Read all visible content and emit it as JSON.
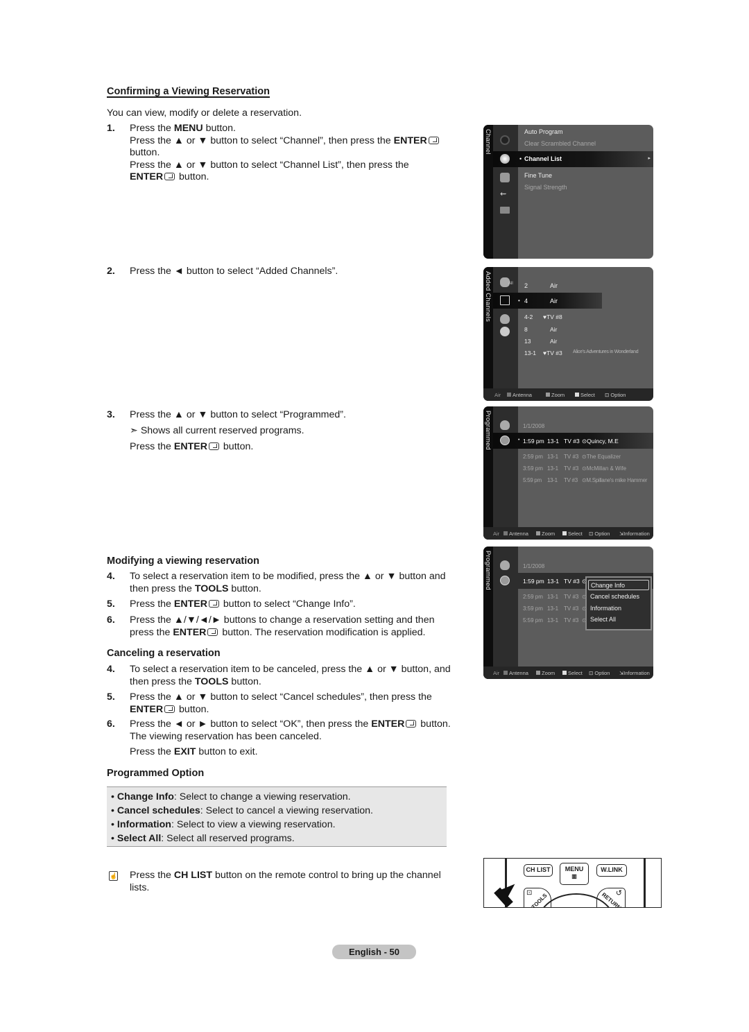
{
  "doc": {
    "section_title": "Confirming a Viewing Reservation",
    "intro": "You can view, modify or delete a reservation.",
    "steps_confirm": [
      {
        "num": "1.",
        "lines": [
          {
            "pre": "Press the ",
            "bold": "MENU",
            "post": " button."
          },
          {
            "pre": "Press the ▲ or ▼ button to select “Channel”, then press the ",
            "bold": "ENTER",
            "post": ""
          },
          {
            "pre": "button.",
            "bold": "",
            "post": ""
          },
          {
            "pre": "Press the ▲ or ▼ button to select “Channel List”, then press the",
            "bold": "",
            "post": ""
          },
          {
            "pre": "",
            "bold": "ENTER",
            "post": " button."
          }
        ]
      },
      {
        "num": "2.",
        "lines": [
          {
            "pre": "Press the ◄ button to select “Added Channels”.",
            "bold": "",
            "post": ""
          }
        ]
      },
      {
        "num": "3.",
        "lines": [
          {
            "pre": "Press the ▲ or ▼ button to select “Programmed”.",
            "bold": "",
            "post": ""
          },
          {
            "pre": "➣  Shows all current reserved programs.",
            "bold": "",
            "post": ""
          },
          {
            "pre": "Press the ",
            "bold": "ENTER",
            "post": " button."
          }
        ]
      }
    ],
    "modify_title": "Modifying a viewing reservation",
    "steps_modify": [
      {
        "num": "4.",
        "l1": "To select a reservation item to be modified, press the ▲ or ▼ button and",
        "l2_pre": "then press the ",
        "l2_bold": "TOOLS",
        "l2_post": " button."
      },
      {
        "num": "5.",
        "l1_pre": "Press the ",
        "l1_bold": "ENTER",
        "l1_post": " button to select “Change Info”."
      },
      {
        "num": "6.",
        "l1": "Press the ▲/▼/◄/► buttons to change a reservation setting and then",
        "l2_pre": "press the ",
        "l2_bold": "ENTER",
        "l2_post": " button. The reservation modification is applied."
      }
    ],
    "cancel_title": "Canceling a reservation",
    "steps_cancel": [
      {
        "num": "4.",
        "l1": "To select a reservation item to be canceled, press the ▲ or ▼ button, and",
        "l2_pre": "then press the ",
        "l2_bold": "TOOLS",
        "l2_post": " button."
      },
      {
        "num": "5.",
        "l1": "Press the ▲ or ▼ button to select “Cancel schedules”, then press the",
        "l2_bold": "ENTER",
        "l2_post": " button."
      },
      {
        "num": "6.",
        "l1_pre": "Press the ◄ or ► button to select “OK”, then press the ",
        "l1_bold": "ENTER",
        "l1_post": " button.",
        "l2": "The viewing reservation has been canceled.",
        "l3_pre": "Press the ",
        "l3_bold": "EXIT",
        "l3_post": " button to exit."
      }
    ],
    "options_title": "Programmed Option",
    "options": [
      {
        "name": "Change Info",
        "desc": ": Select to change a viewing reservation."
      },
      {
        "name": "Cancel schedules",
        "desc": ": Select to cancel a viewing reservation."
      },
      {
        "name": "Information",
        "desc": ": Select to view a viewing reservation."
      },
      {
        "name": "Select All",
        "desc": ": Select all reserved programs."
      }
    ],
    "note": {
      "pre": "Press the ",
      "bold": "CH LIST",
      "post": " button on the remote control to bring up the channel",
      "l2": "lists."
    },
    "page_label": "English - 50"
  },
  "osd_channel": {
    "tab": "Channel",
    "items": [
      "Auto Program",
      "Clear Scrambled Channel",
      "Channel List",
      "Fine Tune",
      "Signal Strength"
    ],
    "selected": "Channel List"
  },
  "osd_added": {
    "tab": "Added Channels",
    "all_label": "All",
    "rows": [
      {
        "ch": "2",
        "name": "Air",
        "prog": ""
      },
      {
        "ch": "4",
        "name": "Air",
        "prog": ""
      },
      {
        "ch": "4-2",
        "name": "♥TV #8",
        "prog": ""
      },
      {
        "ch": "8",
        "name": "Air",
        "prog": ""
      },
      {
        "ch": "13",
        "name": "Air",
        "prog": ""
      },
      {
        "ch": "13-1",
        "name": "♥TV #3",
        "prog": "Alice's Adventures in Wonderland"
      }
    ],
    "footer": {
      "source": "Air",
      "a": "Antenna",
      "b": "Zoom",
      "c": "Select",
      "d": "Option"
    }
  },
  "osd_programmed": {
    "tab": "Programmed",
    "date": "1/1/2008",
    "rows": [
      {
        "time": "1:59 pm",
        "ch": "13-1",
        "name": "TV #3",
        "prog": "Quincy, M.E"
      },
      {
        "time": "2:59 pm",
        "ch": "13-1",
        "name": "TV #3",
        "prog": "The Equalizer"
      },
      {
        "time": "3:59 pm",
        "ch": "13-1",
        "name": "TV #3",
        "prog": "McMillan & Wife"
      },
      {
        "time": "5:59 pm",
        "ch": "13-1",
        "name": "TV #3",
        "prog": "M.Spillane's mike Hammer"
      }
    ],
    "footer": {
      "source": "Air",
      "a": "Antenna",
      "b": "Zoom",
      "c": "Select",
      "d": "Option",
      "e": "Information"
    }
  },
  "osd_tools": {
    "menu": [
      "Change Info",
      "Cancel schedules",
      "Information",
      "Select All"
    ],
    "selected": "Change Info"
  },
  "remote": {
    "ch_list": "CH LIST",
    "menu": "MENU",
    "wlink": "W.LINK",
    "tools": "TOOLS",
    "return": "RETURN"
  },
  "colors": {
    "osd_bg": "#5c5c5c",
    "osd_dark": "#0d0d0d",
    "options_bg": "#e7e7e7",
    "badge": "#c4c4c4"
  }
}
